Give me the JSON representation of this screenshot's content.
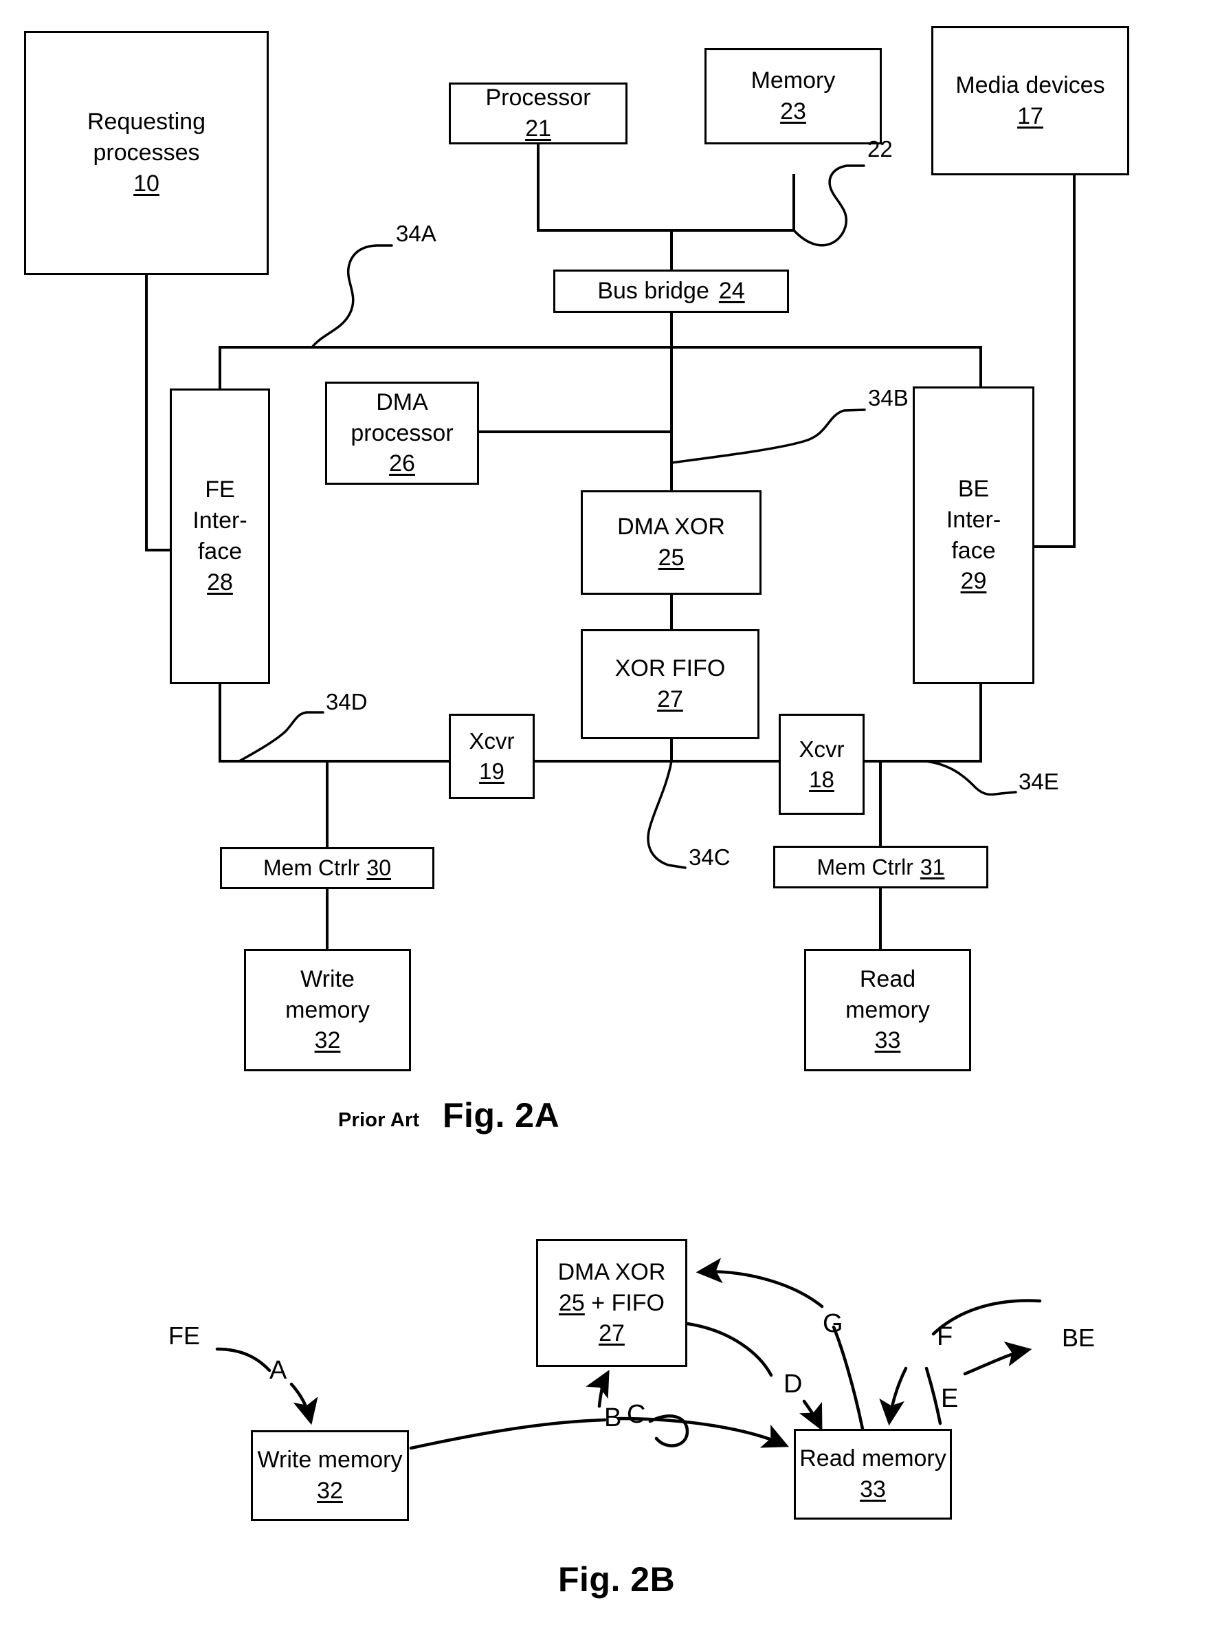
{
  "figures": {
    "fig2a": {
      "caption": "Fig. 2A",
      "prior_art": "Prior Art",
      "blocks": {
        "requesting_processes": {
          "line1": "Requesting",
          "line2": "processes",
          "num": "10"
        },
        "processor": {
          "line1": "Processor",
          "num": "21"
        },
        "memory": {
          "line1": "Memory",
          "num": "23"
        },
        "media_devices": {
          "line1": "Media devices",
          "num": "17"
        },
        "bus_bridge": {
          "line1": "Bus bridge",
          "num": "24"
        },
        "dma_processor": {
          "line1": "DMA",
          "line2": "processor",
          "num": "26"
        },
        "fe_interface": {
          "line1": "FE",
          "line2": "Inter-",
          "line3": "face",
          "num": "28"
        },
        "be_interface": {
          "line1": "BE",
          "line2": "Inter-",
          "line3": "face",
          "num": "29"
        },
        "dma_xor": {
          "line1": "DMA XOR",
          "num": "25"
        },
        "xor_fifo": {
          "line1": "XOR FIFO",
          "num": "27"
        },
        "xcvr_19": {
          "line1": "Xcvr",
          "num": "19"
        },
        "xcvr_18": {
          "line1": "Xcvr",
          "num": "18"
        },
        "mem_ctrlr_30": {
          "line1": "Mem Ctrlr",
          "num": "30"
        },
        "mem_ctrlr_31": {
          "line1": "Mem Ctrlr",
          "num": "31"
        },
        "write_memory": {
          "line1": "Write",
          "line2": "memory",
          "num": "32"
        },
        "read_memory": {
          "line1": "Read",
          "line2": "memory",
          "num": "33"
        }
      },
      "leaders": {
        "l22": "22",
        "l34a": "34A",
        "l34b": "34B",
        "l34c": "34C",
        "l34d": "34D",
        "l34e": "34E"
      }
    },
    "fig2b": {
      "caption": "Fig. 2B",
      "blocks": {
        "dma_xor_fifo": {
          "line1": "DMA XOR",
          "line2_a": "25",
          "line2_b": "+ FIFO",
          "num": "27"
        },
        "write_memory": {
          "line1": "Write memory",
          "num": "32"
        },
        "read_memory": {
          "line1": "Read memory",
          "num": "33"
        }
      },
      "ports": {
        "fe": "FE",
        "be": "BE"
      },
      "flow_labels": {
        "a": "A",
        "b": "B",
        "c": "C",
        "d": "D",
        "e": "E",
        "f": "F",
        "g": "G"
      }
    }
  },
  "colors": {
    "ink": "#000000",
    "paper": "#ffffff"
  }
}
